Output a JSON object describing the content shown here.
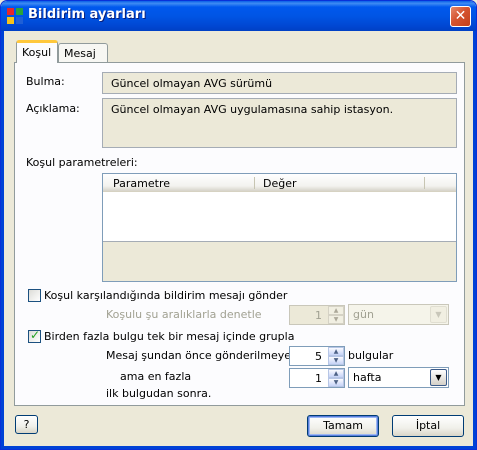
{
  "window": {
    "title": "Bildirim ayarları",
    "close_glyph": "✕"
  },
  "tabs": [
    {
      "label": "Koşul",
      "active": true
    },
    {
      "label": "Mesaj",
      "active": false
    }
  ],
  "fields": {
    "bulma_label": "Bulma:",
    "bulma_value": "Güncel olmayan AVG sürümü",
    "aciklama_label": "Açıklama:",
    "aciklama_value": "Güncel olmayan AVG uygulamasına sahip istasyon."
  },
  "params": {
    "section_label": "Koşul parametreleri:",
    "columns": [
      "Parametre",
      "Değer"
    ],
    "rows": []
  },
  "options": {
    "send_message": {
      "label": "Koşul karşılandığında bildirim mesajı gönder",
      "checked": false
    },
    "check_interval_label": "Koşulu şu aralıklarla denetle",
    "check_interval_value": "1",
    "check_interval_unit": "gün",
    "group_findings": {
      "label": "Birden fazla bulgu tek bir mesaj içinde grupla",
      "checked": true
    },
    "not_before_label": "Mesaj şundan önce gönderilmeyecek",
    "not_before_value": "5",
    "not_before_suffix": "bulgular",
    "at_most_label": "ama en fazla",
    "at_most_value": "1",
    "at_most_unit": "hafta",
    "after_first_label": "ilk bulgudan sonra."
  },
  "footer": {
    "help_label": "?",
    "ok_label": "Tamam",
    "cancel_label": "İptal"
  },
  "icons": {
    "app": "avg-app-icon",
    "close": "close-icon",
    "spin": "spin-arrows-icon",
    "dropdown": "chevron-down-icon"
  },
  "colors": {
    "titlebar": "#0058ee",
    "accent_tab": "#ffc83c",
    "close": "#d5532f"
  }
}
